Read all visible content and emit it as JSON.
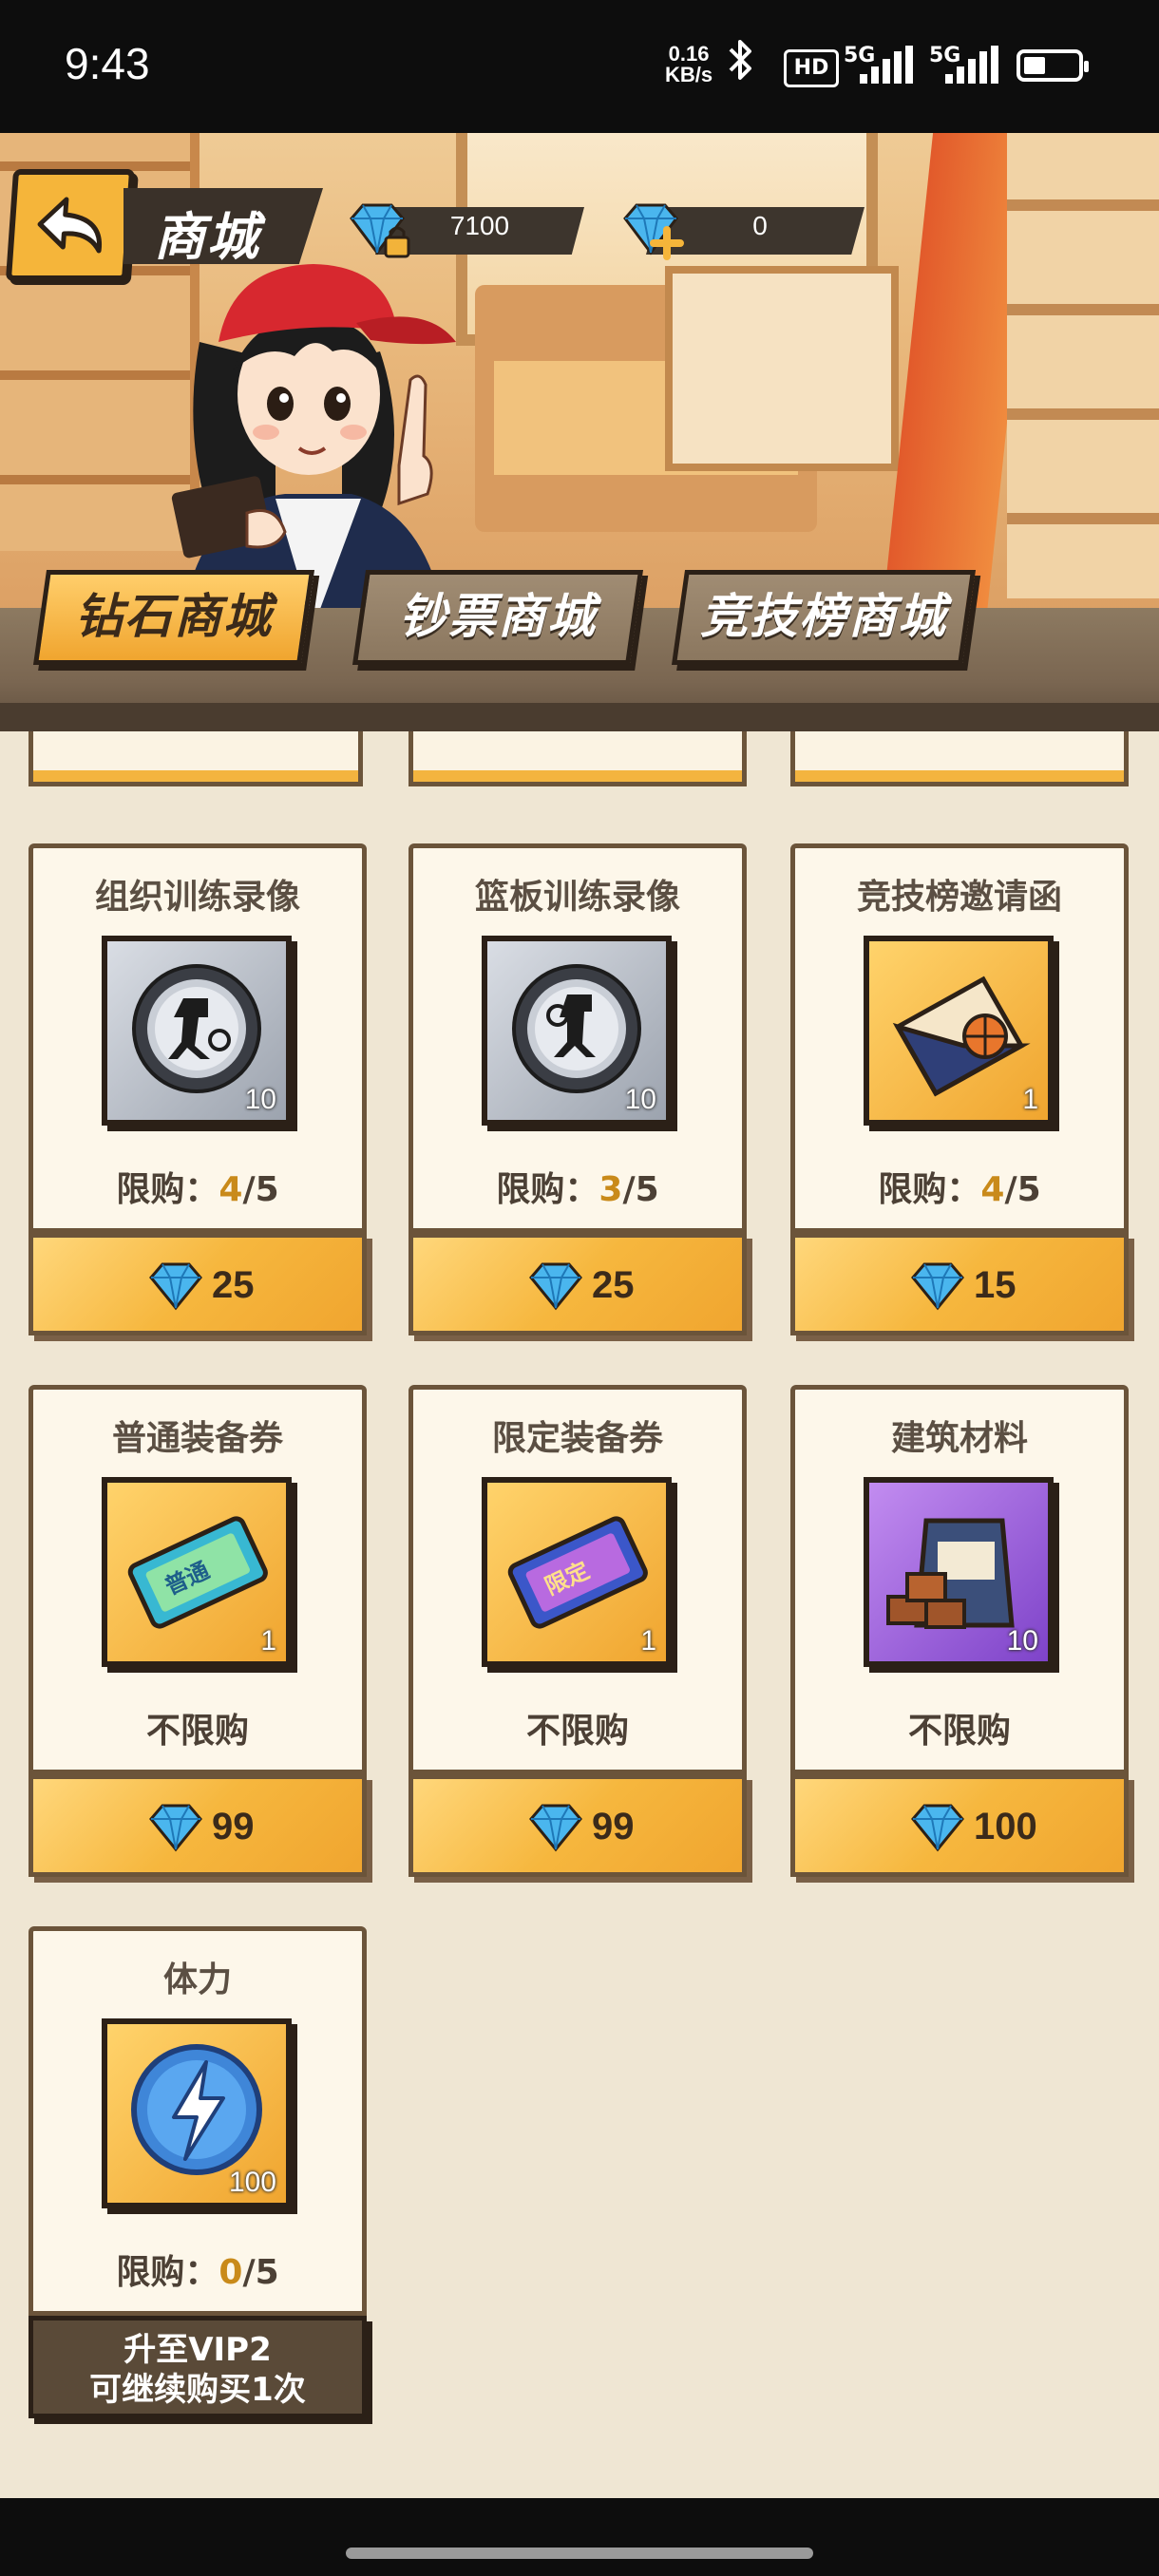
{
  "status_bar": {
    "time": "9:43",
    "net_speed_value": "0.16",
    "net_speed_unit": "KB/s",
    "hd_label": "HD",
    "sim1": "5G",
    "sim2": "5G",
    "battery_percent": 35
  },
  "header": {
    "title": "商城",
    "locked_diamonds": "7100",
    "diamonds": "0"
  },
  "tabs": [
    {
      "label": "钻石商城",
      "active": true
    },
    {
      "label": "钞票商城",
      "active": false
    },
    {
      "label": "竞技榜商城",
      "active": false
    }
  ],
  "items": [
    {
      "name": "组织训练录像",
      "qty": "10",
      "limit_prefix": "限购：",
      "limit_used": "4",
      "limit_total": "/5",
      "price": "25"
    },
    {
      "name": "篮板训练录像",
      "qty": "10",
      "limit_prefix": "限购：",
      "limit_used": "3",
      "limit_total": "/5",
      "price": "25"
    },
    {
      "name": "竞技榜邀请函",
      "qty": "1",
      "limit_prefix": "限购：",
      "limit_used": "4",
      "limit_total": "/5",
      "price": "15"
    },
    {
      "name": "普通装备券",
      "qty": "1",
      "limit_text": "不限购",
      "price": "99",
      "ticket_label": "普通"
    },
    {
      "name": "限定装备券",
      "qty": "1",
      "limit_text": "不限购",
      "price": "99",
      "ticket_label": "限定"
    },
    {
      "name": "建筑材料",
      "qty": "10",
      "limit_text": "不限购",
      "price": "100"
    },
    {
      "name": "体力",
      "qty": "100",
      "limit_prefix": "限购：",
      "limit_used": "0",
      "limit_total": "/5",
      "vip_line1": "升至VIP2",
      "vip_line2": "可继续购买1次"
    }
  ],
  "icons": {
    "back": "back-arrow-icon",
    "diamond": "diamond-icon",
    "lock": "lock-icon",
    "plus": "plus-icon",
    "bluetooth": "bluetooth-icon"
  },
  "colors": {
    "accent": "#f5b53a",
    "panel_dark": "#3a3129",
    "card_bg": "#fdf7ea",
    "limit_highlight": "#c98a1a",
    "diamond": "#3aa8e6"
  }
}
